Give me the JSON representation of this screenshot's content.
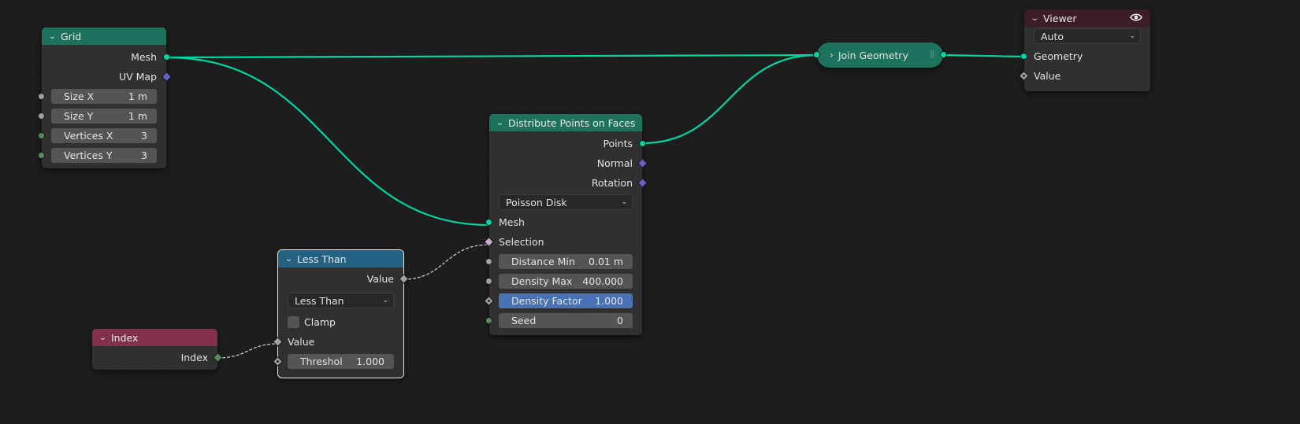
{
  "editor": "Geometry Nodes",
  "colors": {
    "geometry_link": "#00d6a3",
    "float_link": "#c8c8c8",
    "geometry_socket": "#00d6a3",
    "vector_socket": "#6363c7",
    "float_socket": "#a1a1a1",
    "int_socket": "#598c5c",
    "bool_socket": "#cca6d6",
    "header_geometry": "#1d725e",
    "header_converter": "#246283",
    "header_input": "#83314a",
    "header_output": "#3c1d26",
    "selected_field": "#4772b3"
  },
  "nodes": {
    "grid": {
      "title": "Grid",
      "outputs": [
        "Mesh",
        "UV Map"
      ],
      "inputs": [
        {
          "label": "Size X",
          "value": "1 m"
        },
        {
          "label": "Size Y",
          "value": "1 m"
        },
        {
          "label": "Vertices X",
          "value": "3"
        },
        {
          "label": "Vertices Y",
          "value": "3"
        }
      ]
    },
    "join": {
      "title": "Join Geometry",
      "collapsed": true
    },
    "viewer": {
      "title": "Viewer",
      "icon": "eye-icon",
      "domain": "Auto",
      "inputs": [
        "Geometry",
        "Value"
      ]
    },
    "distribute": {
      "title": "Distribute Points on Faces",
      "outputs": [
        "Points",
        "Normal",
        "Rotation"
      ],
      "mode": "Poisson Disk",
      "inputs": [
        "Mesh",
        "Selection"
      ],
      "fields": [
        {
          "label": "Distance Min",
          "value": "0.01 m"
        },
        {
          "label": "Density Max",
          "value": "400.000"
        },
        {
          "label": "Density Factor",
          "value": "1.000"
        },
        {
          "label": "Seed",
          "value": "0"
        }
      ]
    },
    "less_than": {
      "title": "Less Than",
      "output": "Value",
      "operation": "Less Than",
      "clamp_label": "Clamp",
      "clamp_checked": false,
      "input": "Value",
      "threshold": {
        "label": "Threshol",
        "value": "1.000"
      }
    },
    "index": {
      "title": "Index",
      "output": "Index"
    }
  }
}
